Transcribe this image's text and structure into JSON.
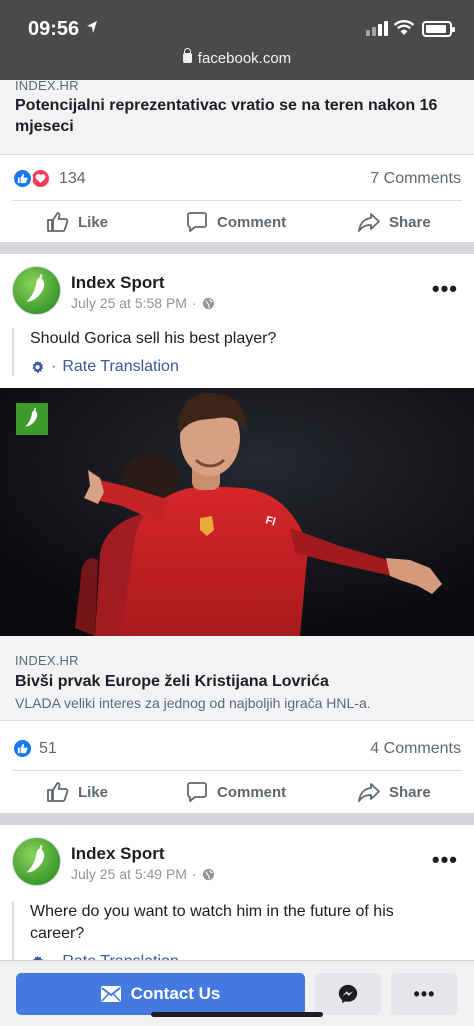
{
  "status_bar": {
    "time": "09:56",
    "url": "facebook.com"
  },
  "post1": {
    "link_source": "INDEX.HR",
    "link_title": "Potencijalni reprezentativac vratio se na teren nakon 16 mjeseci",
    "reaction_count": "134",
    "comments": "7 Comments",
    "actions": {
      "like": "Like",
      "comment": "Comment",
      "share": "Share"
    }
  },
  "post2": {
    "page_name": "Index Sport",
    "timestamp": "July 25 at 5:58 PM",
    "text": "Should Gorica sell his best player?",
    "rate_translation": "Rate Translation",
    "link_source": "INDEX.HR",
    "link_title": "Bivši prvak Europe želi Kristijana Lovrića",
    "link_desc": "VLADA veliki interes za jednog od najboljih igrača HNL-a.",
    "reaction_count": "51",
    "comments": "4 Comments",
    "actions": {
      "like": "Like",
      "comment": "Comment",
      "share": "Share"
    }
  },
  "post3": {
    "page_name": "Index Sport",
    "timestamp": "July 25 at 5:49 PM",
    "text": "Where do you want to watch him in the future of his career?",
    "rate_translation": "Rate Translation"
  },
  "bottom_bar": {
    "contact_label": "Contact Us"
  },
  "colors": {
    "facebook_blue": "#1877f2",
    "contact_button": "#4379e0",
    "love_red": "#f33e58",
    "link_blue": "#385898",
    "avatar_green": "#3e9a2d"
  }
}
